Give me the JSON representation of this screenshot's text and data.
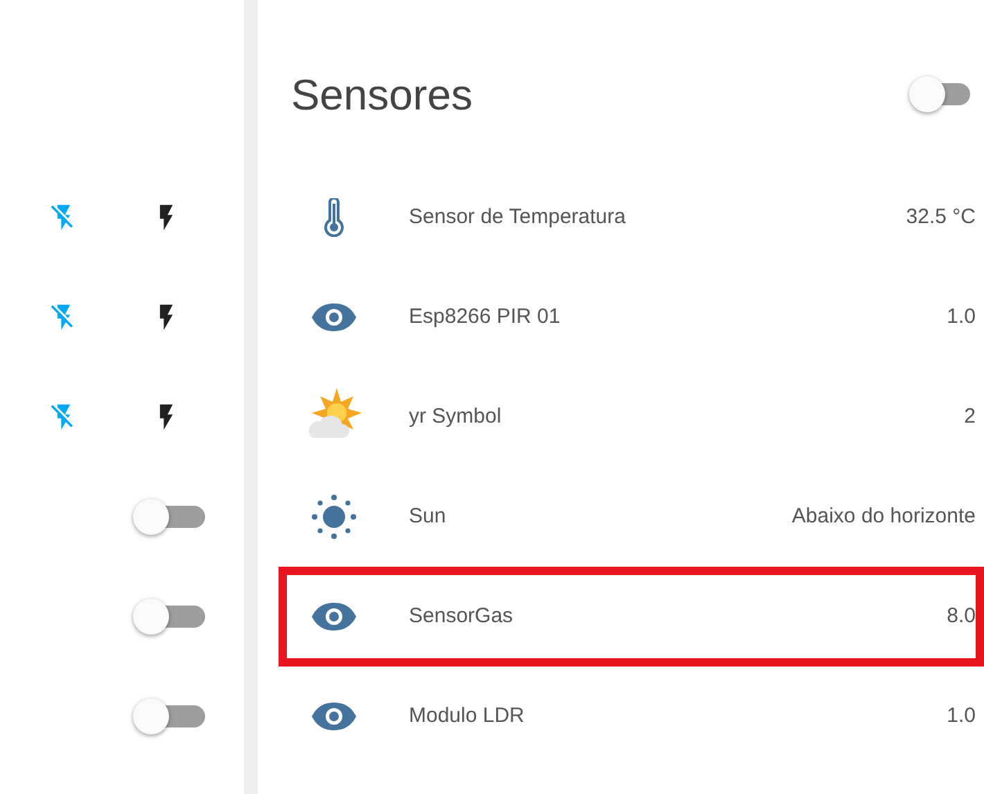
{
  "controls": [
    {
      "kind": "flash_buttons"
    },
    {
      "kind": "flash_buttons"
    },
    {
      "kind": "flash_buttons"
    },
    {
      "kind": "switch",
      "on": false
    },
    {
      "kind": "switch",
      "on": false
    },
    {
      "kind": "switch",
      "on": false
    }
  ],
  "card": {
    "title": "Sensores",
    "on": false,
    "items": [
      {
        "kind": "thermometer",
        "name": "Sensor de Temperatura",
        "value": "32.5 °C",
        "highlighted": false
      },
      {
        "kind": "eye",
        "name": "Esp8266 PIR 01",
        "value": "1.0",
        "highlighted": false
      },
      {
        "kind": "weather",
        "name": "yr Symbol",
        "value": "2",
        "highlighted": false
      },
      {
        "kind": "sun",
        "name": "Sun",
        "value": "Abaixo do horizonte",
        "highlighted": false
      },
      {
        "kind": "eye",
        "name": "SensorGas",
        "value": "8.0",
        "highlighted": true
      },
      {
        "kind": "eye",
        "name": "Modulo LDR",
        "value": "1.0",
        "highlighted": false
      }
    ]
  }
}
